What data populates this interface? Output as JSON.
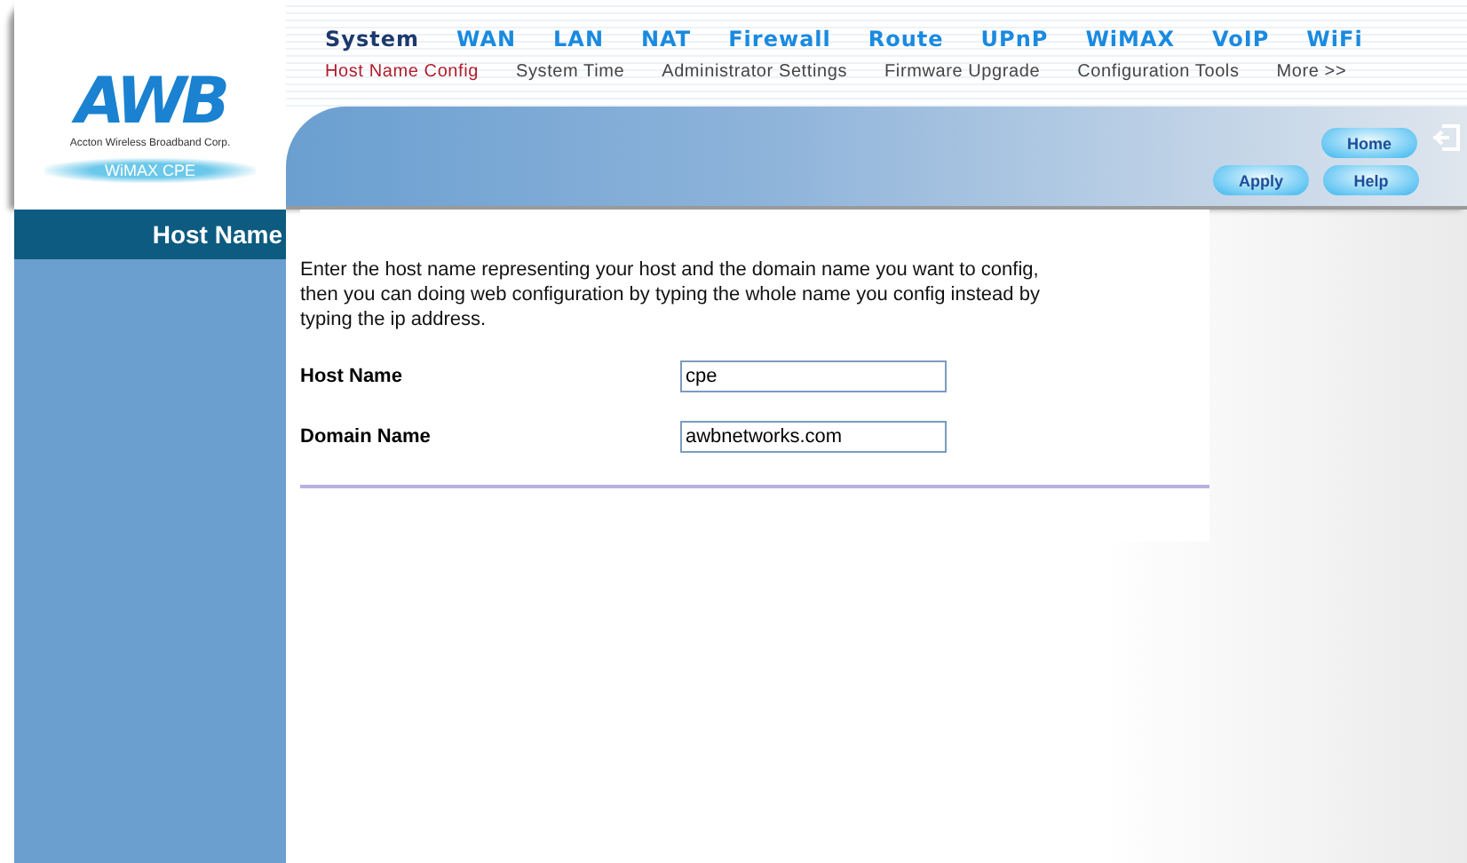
{
  "logo": {
    "mark": "AWB",
    "company": "Accton Wireless Broadband Corp.",
    "product": "WiMAX CPE"
  },
  "menu": [
    {
      "label": "System",
      "selected": true
    },
    {
      "label": "WAN",
      "selected": false
    },
    {
      "label": "LAN",
      "selected": false
    },
    {
      "label": "NAT",
      "selected": false
    },
    {
      "label": "Firewall",
      "selected": false
    },
    {
      "label": "Route",
      "selected": false
    },
    {
      "label": "UPnP",
      "selected": false
    },
    {
      "label": "WiMAX",
      "selected": false
    },
    {
      "label": "VoIP",
      "selected": false
    },
    {
      "label": "WiFi",
      "selected": false
    }
  ],
  "submenu": [
    {
      "label": "Host Name Config",
      "selected": true
    },
    {
      "label": "System Time",
      "selected": false
    },
    {
      "label": "Administrator Settings",
      "selected": false
    },
    {
      "label": "Firmware Upgrade",
      "selected": false
    },
    {
      "label": "Configuration Tools",
      "selected": false
    },
    {
      "label": "More >>",
      "selected": false
    }
  ],
  "buttons": {
    "home": "Home",
    "apply": "Apply",
    "help": "Help"
  },
  "sidebar": {
    "title": "Host Name"
  },
  "content": {
    "description": "Enter the host name representing your host and the domain name you want to config, then you can doing web configuration by typing the whole name you config instead by typing the ip address.",
    "fields": [
      {
        "label": "Host Name",
        "value": "cpe"
      },
      {
        "label": "Domain Name",
        "value": "awbnetworks.com"
      }
    ]
  }
}
